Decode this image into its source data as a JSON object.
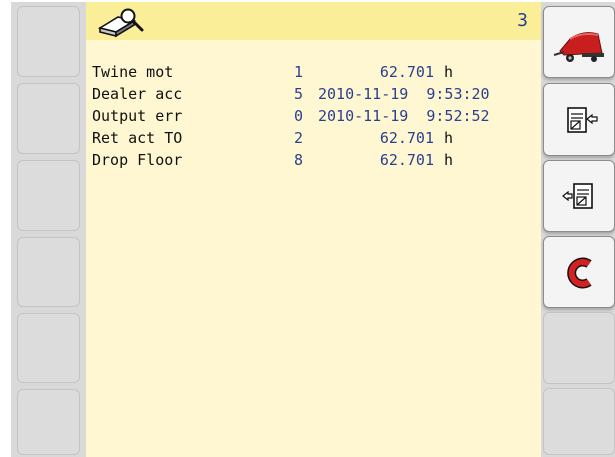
{
  "header": {
    "page_number": "3",
    "icon": "bale-search-icon"
  },
  "faults": [
    {
      "name": "Twine mot",
      "count": "1",
      "value": "62.701",
      "unit": "h"
    },
    {
      "name": "Dealer acc",
      "count": "5",
      "value": "2010-11-19  9:53:20",
      "unit": ""
    },
    {
      "name": "Output err",
      "count": "0",
      "value": "2010-11-19  9:52:52",
      "unit": ""
    },
    {
      "name": "Ret act TO",
      "count": "2",
      "value": "62.701",
      "unit": "h"
    },
    {
      "name": "Drop Floor",
      "count": "8",
      "value": "62.701",
      "unit": "h"
    }
  ],
  "softkeys": {
    "right": [
      {
        "icon": "baler-machine-icon"
      },
      {
        "icon": "export-document-icon"
      },
      {
        "icon": "import-document-icon"
      },
      {
        "icon": "reset-counter-icon",
        "color": "#d42020"
      }
    ]
  },
  "colors": {
    "display_background": "#fff7d1",
    "header_background": "#fbee98",
    "value_text": "#2a3f90",
    "label_text": "#111111",
    "accent_red": "#d42020"
  }
}
